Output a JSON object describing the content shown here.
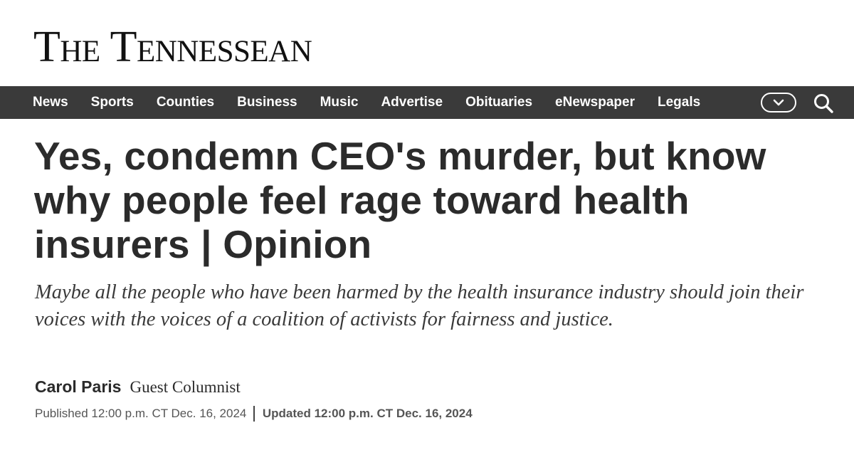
{
  "masthead": {
    "logo_text": "The Tennessean"
  },
  "nav": {
    "items": [
      {
        "label": "News"
      },
      {
        "label": "Sports"
      },
      {
        "label": "Counties"
      },
      {
        "label": "Business"
      },
      {
        "label": "Music"
      },
      {
        "label": "Advertise"
      },
      {
        "label": "Obituaries"
      },
      {
        "label": "eNewspaper"
      },
      {
        "label": "Legals"
      }
    ],
    "more_icon": "chevron-down-icon",
    "search_icon": "search-icon",
    "background_color": "#3a3a3a"
  },
  "article": {
    "headline": "Yes, condemn CEO's murder, but know why people feel rage toward health insurers | Opinion",
    "dek": "Maybe all the people who have been harmed by the health insurance industry should join their voices with the voices of a coalition of activists for fairness and justice.",
    "author": "Carol Paris",
    "author_title": "Guest Columnist",
    "published": "Published 12:00 p.m. CT Dec. 16, 2024",
    "updated": "Updated 12:00 p.m. CT Dec. 16, 2024"
  }
}
